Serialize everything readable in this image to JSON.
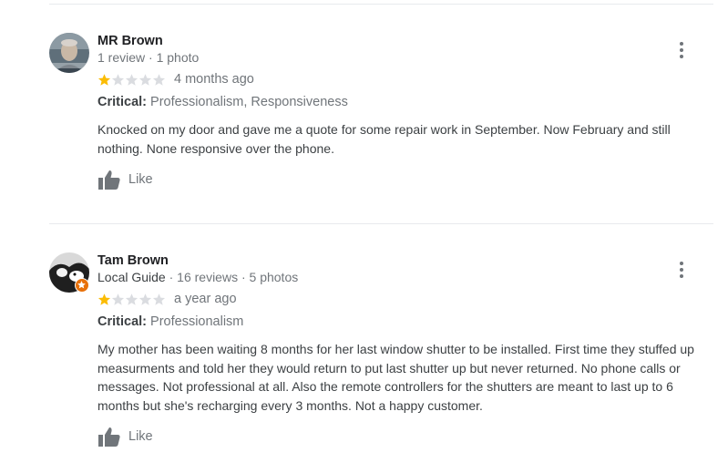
{
  "reviews": [
    {
      "name": "MR Brown",
      "meta": "1 review · 1 photo",
      "rating": 1,
      "max_rating": 5,
      "time": "4 months ago",
      "critical_label": "Critical:",
      "critical_items": "Professionalism, Responsiveness",
      "text": "Knocked on my door and gave me a quote for some repair work in September. Now February and still nothing. None responsive over the phone.",
      "like_label": "Like",
      "local_guide": false
    },
    {
      "name": "Tam Brown",
      "meta_guide": "Local Guide",
      "meta": "· 16 reviews · 5 photos",
      "rating": 1,
      "max_rating": 5,
      "time": "a year ago",
      "critical_label": "Critical:",
      "critical_items": "Professionalism",
      "text": "My mother has been waiting 8 months for her last window shutter to be installed. First time they stuffed up measurments and told her they would return to put last shutter up but never returned. No phone calls or messages. Not professional at all. Also the remote controllers for the shutters are meant to last up to 6 months but she's recharging every 3 months. Not a happy customer.",
      "like_label": "Like",
      "local_guide": true
    }
  ],
  "colors": {
    "star_filled": "#fbbc04",
    "star_empty": "#dadce0",
    "icon_grey": "#70757a",
    "guide_badge": "#e8710a"
  },
  "icons": {
    "more": "more-vert-icon",
    "like": "thumbs-up-icon",
    "guide": "local-guide-badge-icon"
  }
}
